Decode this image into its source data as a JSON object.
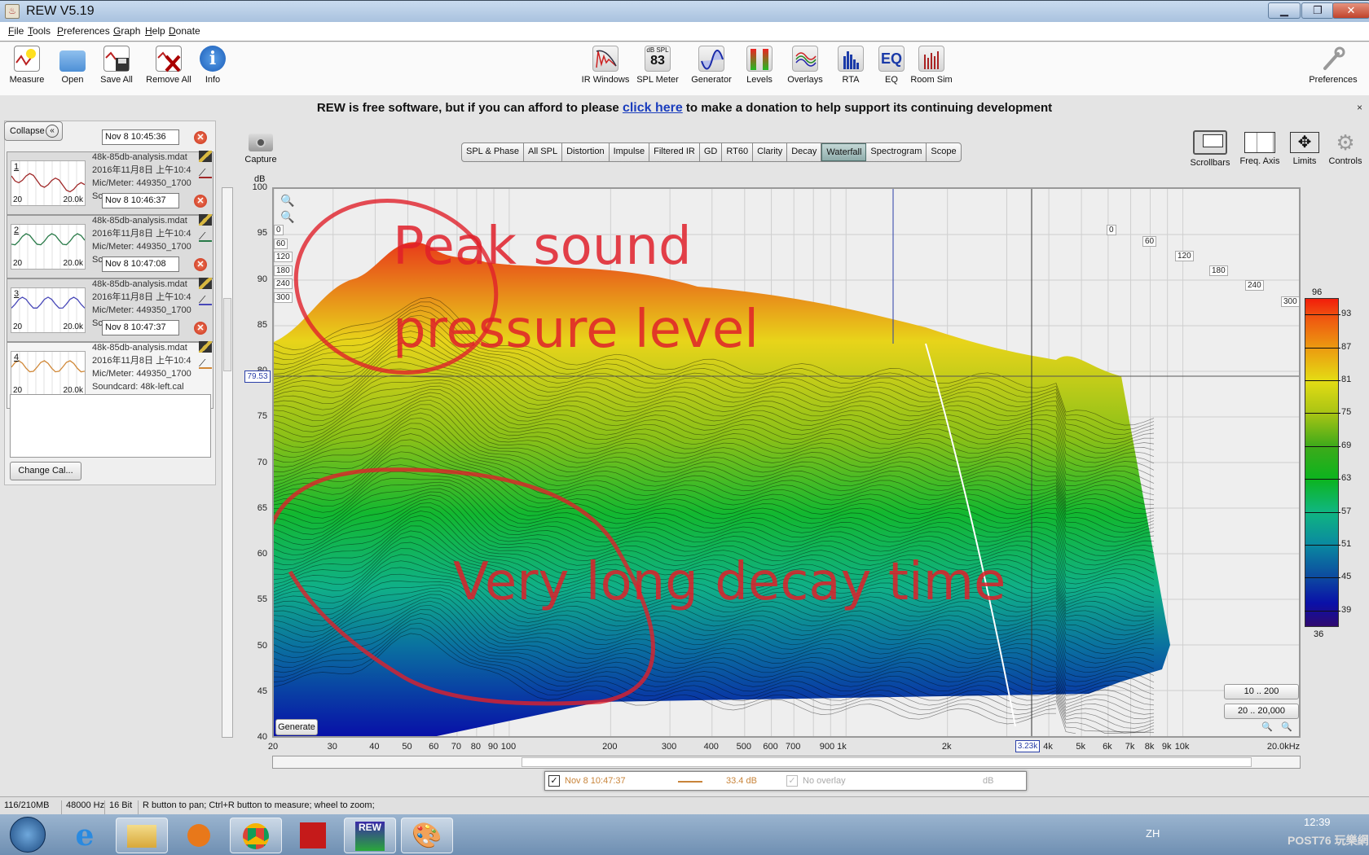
{
  "window": {
    "title": "REW V5.19",
    "min_icon": "minimize-icon",
    "max_icon": "restore-icon",
    "close_icon": "close-icon"
  },
  "menu": [
    "File",
    "Tools",
    "Preferences",
    "Graph",
    "Help",
    "Donate"
  ],
  "toolbar_left": [
    {
      "label": "Measure",
      "icon": "measure-icon"
    },
    {
      "label": "Open",
      "icon": "folder-icon"
    },
    {
      "label": "Save All",
      "icon": "save-all-icon"
    },
    {
      "label": "Remove All",
      "icon": "remove-all-icon"
    },
    {
      "label": "Info",
      "icon": "info-icon"
    }
  ],
  "toolbar_center": [
    {
      "label": "IR Windows",
      "icon": "ir-windows-icon"
    },
    {
      "label": "SPL Meter",
      "icon": "spl-meter-icon",
      "badge_top": "dB SPL",
      "badge_value": "83"
    },
    {
      "label": "Generator",
      "icon": "generator-icon"
    },
    {
      "label": "Levels",
      "icon": "levels-icon"
    },
    {
      "label": "Overlays",
      "icon": "overlays-icon"
    },
    {
      "label": "RTA",
      "icon": "rta-icon"
    },
    {
      "label": "EQ",
      "icon": "eq-icon",
      "badge_value": "EQ"
    },
    {
      "label": "Room Sim",
      "icon": "room-sim-icon"
    }
  ],
  "toolbar_right": {
    "label": "Preferences",
    "icon": "wrench-icon"
  },
  "donate": {
    "before": "REW is free software, but if you can afford to please ",
    "link": "click here",
    "after": " to make a donation to help support its continuing development",
    "close": "×"
  },
  "panel": {
    "collapse_label": "Collapse",
    "change_cal": "Change Cal...",
    "measurements": [
      {
        "num": "1",
        "time": "Nov 8 10:45:36",
        "file": "48k-85db-analysis.mdat",
        "date": "2016年11月8日 上午10:4",
        "mic": "Mic/Meter: 449350_1700",
        "sc": "Sc",
        "color": "#a02828",
        "fmin": "20",
        "fmax": "20.0k"
      },
      {
        "num": "2",
        "time": "Nov 8 10:46:37",
        "file": "48k-85db-analysis.mdat",
        "date": "2016年11月8日 上午10:4",
        "mic": "Mic/Meter: 449350_1700",
        "sc": "Sc",
        "color": "#287a48",
        "fmin": "20",
        "fmax": "20.0k"
      },
      {
        "num": "3",
        "time": "Nov 8 10:47:08",
        "file": "48k-85db-analysis.mdat",
        "date": "2016年11月8日 上午10:4",
        "mic": "Mic/Meter: 449350_1700",
        "sc": "Sc",
        "color": "#4848b8",
        "fmin": "20",
        "fmax": "20.0k"
      },
      {
        "num": "4",
        "time": "Nov 8 10:47:37",
        "file": "48k-85db-analysis.mdat",
        "date": "2016年11月8日 上午10:4",
        "mic": "Mic/Meter: 449350_1700",
        "sc": "Soundcard: 48k-left.cal",
        "color": "#d08838",
        "fmin": "20",
        "fmax": "20.0k"
      }
    ]
  },
  "capture": "Capture",
  "graph_tabs": [
    {
      "label": "SPL & Phase"
    },
    {
      "label": "All SPL"
    },
    {
      "label": "Distortion"
    },
    {
      "label": "Impulse"
    },
    {
      "label": "Filtered IR"
    },
    {
      "label": "GD"
    },
    {
      "label": "RT60"
    },
    {
      "label": "Clarity"
    },
    {
      "label": "Decay"
    },
    {
      "label": "Waterfall",
      "active": true
    },
    {
      "label": "Spectrogram"
    },
    {
      "label": "Scope"
    }
  ],
  "graph_tools": [
    {
      "label": "Scrollbars",
      "icon": "scrollbars-icon"
    },
    {
      "label": "Freq. Axis",
      "icon": "freq-axis-icon"
    },
    {
      "label": "Limits",
      "icon": "limits-icon"
    },
    {
      "label": "Controls",
      "icon": "gear-icon"
    }
  ],
  "plot": {
    "y_unit": "dB",
    "y_ticks": [
      "100",
      "95",
      "90",
      "85",
      "80",
      "75",
      "70",
      "65",
      "60",
      "55",
      "50",
      "45",
      "40"
    ],
    "x_ticks": [
      "20",
      "30",
      "40",
      "50",
      "60",
      "70",
      "80",
      "90",
      "100",
      "200",
      "300",
      "400",
      "500",
      "600",
      "700",
      "900 1k",
      "2k",
      "4k",
      "5k",
      "6k",
      "7k",
      "8k",
      "9k",
      "10k",
      "20.0kHz"
    ],
    "cursor_y": "79.53",
    "cursor_x": "3.23k",
    "time_labels_left": [
      "0",
      "60",
      "120",
      "180",
      "240",
      "300"
    ],
    "time_labels_right": [
      "0",
      "60",
      "120",
      "180",
      "240",
      "300"
    ],
    "time_window": "300ms",
    "generate": "Generate",
    "range_buttons": [
      "10 .. 200",
      "20 .. 20,000"
    ],
    "colorbar": {
      "min": "36",
      "max": "96",
      "ticks": [
        "93",
        "87",
        "81",
        "75",
        "69",
        "63",
        "57",
        "51",
        "45",
        "39"
      ]
    },
    "annotations": [
      "Peak sound",
      "pressure level",
      "Very long decay time"
    ]
  },
  "legend": {
    "name": "Nov 8 10:47:37",
    "value": "33.4 dB",
    "overlay": "No overlay",
    "unit": "dB",
    "color": "#c8843a"
  },
  "status": {
    "memory": "116/210MB",
    "rate": "48000 Hz",
    "bits": "16 Bit",
    "hint": "R button to pan; Ctrl+R button to measure; wheel to zoom;"
  },
  "taskbar": {
    "lang": "ZH",
    "time": "12:39",
    "watermark": "POST76 玩樂網"
  }
}
